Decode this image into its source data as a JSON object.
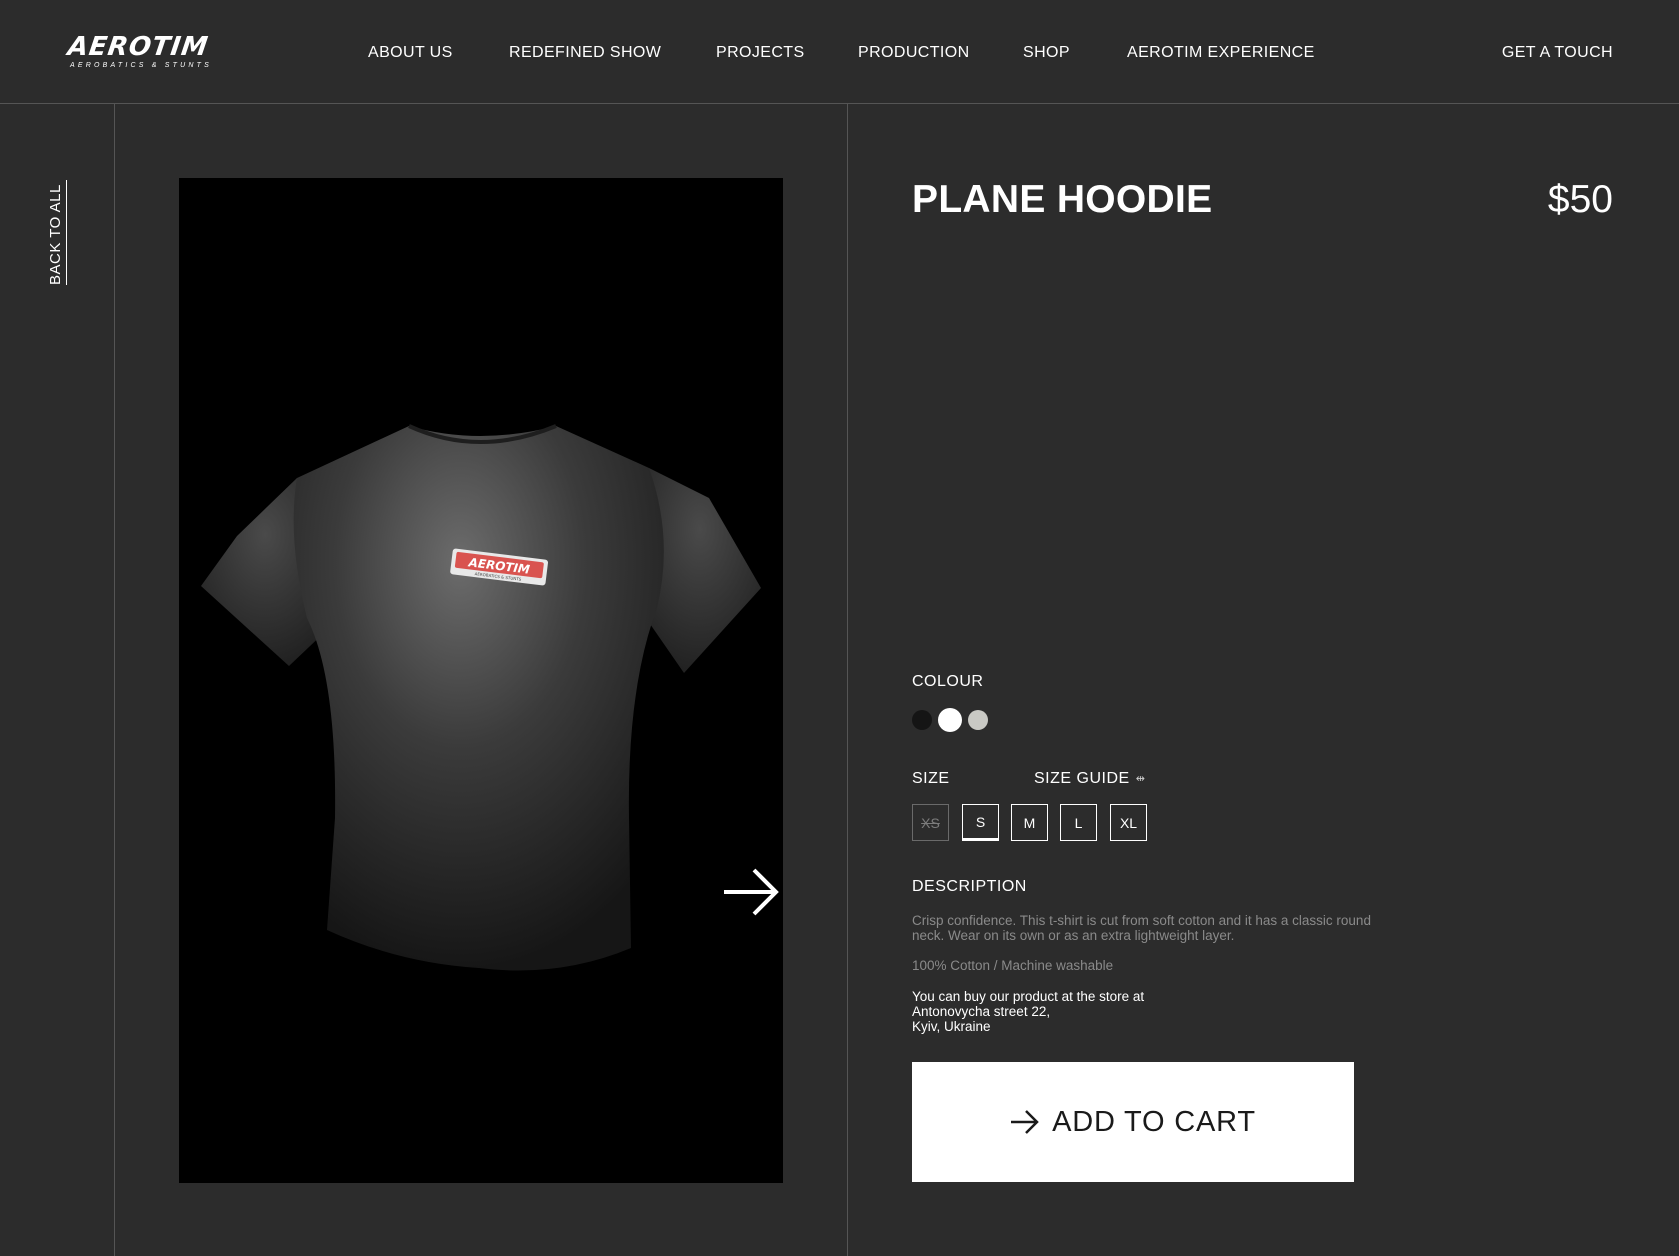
{
  "header": {
    "logo": {
      "name": "AEROTIM",
      "tagline": "AEROBATICS & STUNTS"
    },
    "nav": [
      {
        "label": "ABOUT US"
      },
      {
        "label": "REDEFINED SHOW"
      },
      {
        "label": "PROJECTS"
      },
      {
        "label": "PRODUCTION"
      },
      {
        "label": "SHOP"
      },
      {
        "label": "AEROTIM EXPERIENCE"
      }
    ],
    "cta": "GET A TOUCH"
  },
  "back_link": "BACK TO ALL",
  "product": {
    "title": "PLANE HOODIE",
    "price": "$50",
    "image": {
      "description_icon": "tshirt-image",
      "print_logo": "AEROTIM",
      "print_tagline": "AEROBATICS & STUNTS"
    },
    "colour": {
      "label": "COLOUR",
      "options": [
        {
          "color": "#151515",
          "selected": false
        },
        {
          "color": "#ffffff",
          "selected": true
        },
        {
          "color": "#c9c9c4",
          "selected": false
        }
      ]
    },
    "size": {
      "label": "SIZE",
      "guide_label": "SIZE GUIDE",
      "guide_icon": "ruler-icon",
      "options": [
        {
          "label": "XS",
          "available": false,
          "selected": false
        },
        {
          "label": "S",
          "available": true,
          "selected": true
        },
        {
          "label": "M",
          "available": true,
          "selected": false
        },
        {
          "label": "L",
          "available": true,
          "selected": false
        },
        {
          "label": "XL",
          "available": true,
          "selected": false
        }
      ]
    },
    "description": {
      "label": "DESCRIPTION",
      "text": "Crisp confidence. This t-shirt is cut from soft cotton and it has a classic round neck. Wear on its own or as an extra lightweight layer.",
      "material": "100% Cotton / Machine washable",
      "store_lines": [
        "You can buy our product at the store at",
        "Antonovycha street 22,",
        "Kyiv, Ukraine"
      ]
    },
    "add_to_cart": "ADD TO CART"
  },
  "colors": {
    "background": "#2c2c2c",
    "divider": "#555555",
    "text": "#ffffff",
    "muted_text": "#8a8a8a",
    "button_bg": "#ffffff",
    "button_text": "#1a1a1a",
    "logo_patch": "#d9534f"
  }
}
